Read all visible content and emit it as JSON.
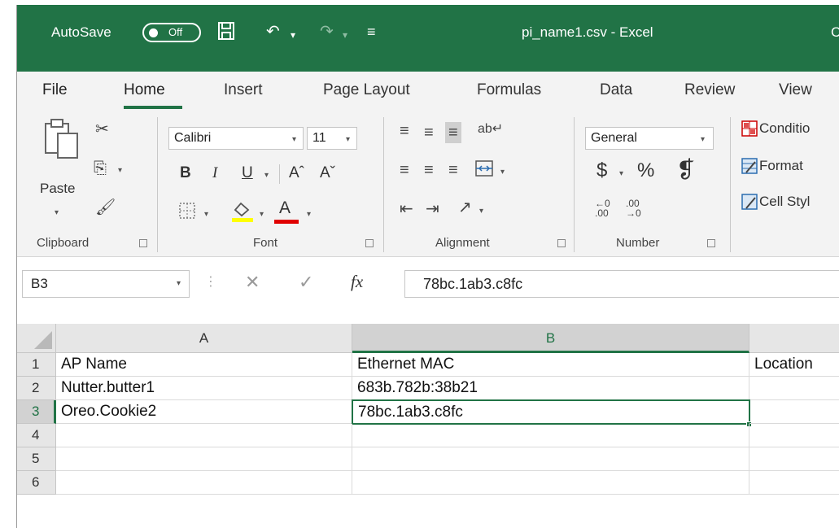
{
  "titlebar": {
    "autosave_label": "AutoSave",
    "autosave_state": "Off",
    "document_title": "pi_name1.csv  -  Excel",
    "edge_fragment": "C"
  },
  "tabs": [
    {
      "label": "File"
    },
    {
      "label": "Home"
    },
    {
      "label": "Insert"
    },
    {
      "label": "Page Layout"
    },
    {
      "label": "Formulas"
    },
    {
      "label": "Data"
    },
    {
      "label": "Review"
    },
    {
      "label": "View"
    }
  ],
  "ribbon": {
    "clipboard": {
      "label": "Clipboard",
      "paste_label": "Paste"
    },
    "font": {
      "label": "Font",
      "font_name": "Calibri",
      "font_size": "11",
      "bold": "B",
      "italic": "I",
      "underline": "U",
      "grow": "Aˆ",
      "shrink": "Aˇ",
      "font_color_letter": "A"
    },
    "alignment": {
      "label": "Alignment"
    },
    "number": {
      "label": "Number",
      "format": "General",
      "currency": "$",
      "percent": "%",
      "comma": "❡"
    },
    "styles": {
      "conditional": "Conditio",
      "format_table": "Format",
      "cell_styles": "Cell Styl"
    },
    "colors": {
      "accent": "#217346",
      "highlight": "#ffff00",
      "font_color": "#e00000"
    }
  },
  "formula_bar": {
    "name_box": "B3",
    "fx": "fx",
    "value": "78bc.1ab3.c8fc"
  },
  "sheet": {
    "columns": [
      "A",
      "B"
    ],
    "rows": [
      {
        "num": "1",
        "a": "AP Name",
        "b": "Ethernet MAC",
        "c": "Location"
      },
      {
        "num": "2",
        "a": "Nutter.butter1",
        "b": "683b.782b:38b21",
        "c": ""
      },
      {
        "num": "3",
        "a": "Oreo.Cookie2",
        "b": "78bc.1ab3.c8fc",
        "c": ""
      },
      {
        "num": "4",
        "a": "",
        "b": "",
        "c": ""
      },
      {
        "num": "5",
        "a": "",
        "b": "",
        "c": ""
      },
      {
        "num": "6",
        "a": "",
        "b": "",
        "c": ""
      }
    ]
  }
}
